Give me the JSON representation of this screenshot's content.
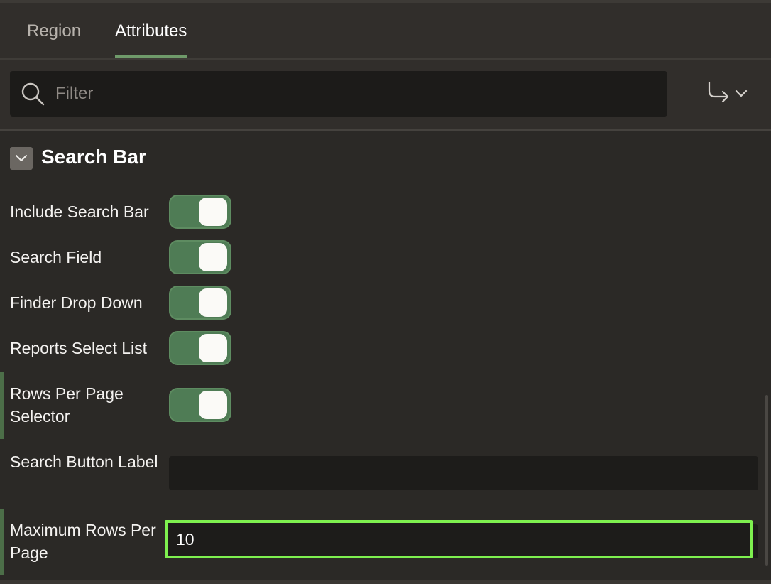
{
  "tabs": [
    {
      "label": "Region",
      "active": false
    },
    {
      "label": "Attributes",
      "active": true
    }
  ],
  "filter": {
    "placeholder": "Filter",
    "value": ""
  },
  "section": {
    "title": "Search Bar",
    "toggles": [
      {
        "label": "Include Search Bar",
        "on": true
      },
      {
        "label": "Search Field",
        "on": true
      },
      {
        "label": "Finder Drop Down",
        "on": true
      },
      {
        "label": "Reports Select List",
        "on": true
      },
      {
        "label": "Rows Per Page Selector",
        "on": true
      }
    ],
    "search_button_label": {
      "label": "Search Button Label",
      "value": ""
    },
    "max_rows": {
      "label": "Maximum Rows Per Page",
      "value": "10"
    }
  },
  "colors": {
    "accent": "#6f9a6a",
    "toggle_on": "#4f7c55",
    "focus": "#7ef04f"
  },
  "icons": {
    "search": "search-icon",
    "goto": "goto-group-icon",
    "collapse": "chevron-down-icon"
  }
}
